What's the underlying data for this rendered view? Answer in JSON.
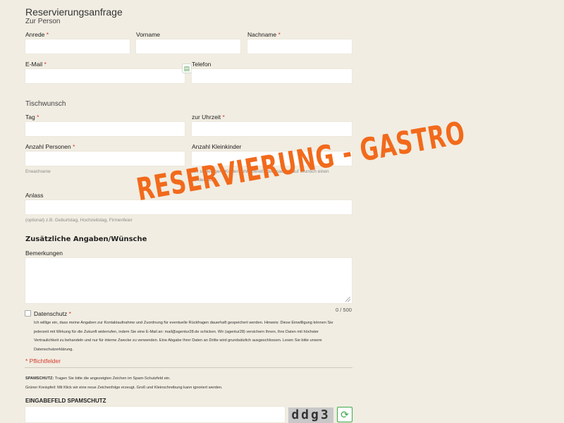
{
  "form": {
    "title": "Reservierungsanfrage",
    "section_person": "Zur Person",
    "anrede": "Anrede",
    "vorname": "Vorname",
    "nachname": "Nachname",
    "email": "E-Mail",
    "telefon": "Telefon",
    "section_tisch": "Tischwunsch",
    "tag": "Tag",
    "uhrzeit": "zur Uhrzeit",
    "personen": "Anzahl Personen",
    "personen_hint": "Erwachsene",
    "kleinkinder": "Anzahl Kleinkinder",
    "kleinkinder_hint_1": "Wir stellen gern Kinderstühle bereit oder machen auf Wunsch einen",
    "kleinkinder_hint_2": "Kindertisch.",
    "anlass": "Anlass",
    "anlass_hint": "(optional) z.B. Geburtstag, Hochzeitstag, Firmenfeier",
    "zusaetzliche": "Zusätzliche Angaben/Wünsche",
    "bemerkungen": "Bemerkungen",
    "counter": "0 / 500",
    "datenschutz": "Datenschutz",
    "consent_1": "Ich willige ein, dass meine Angaben zur Kontaktaufnahme und Zuordnung für eventuelle Rückfragen dauerhaft gespeichert werden. Hinweis: Diese Einwilligung können Sie",
    "consent_2": "jederzeit mit Wirkung für die Zukunft widerrufen, indem Sie eine E-Mail an: mail@agentur28.de schicken. Wir (agentur28) versichern Ihnen, Ihre Daten mit höchster",
    "consent_3": "Vertraulichkeit zu behandeln und nur für interne Zwecke zu verwenden. Eine Abgabe Ihrer Daten an Dritte wird grundsätzlich ausgeschlossen. Lesen Sie bitte unsere",
    "consent_4": "Datenschutzerklärung.",
    "pflicht": "* Pflichtfelder",
    "spam_label": "SPAMSCHUTZ:",
    "spam_text": " Tragen Sie bitte die angezeigten Zeichen im Spam-Schutzfeld ein.",
    "spam_text_2": "Grüner Kreispfeil: Mit Klick wir eine neue Zeichenfolge erzeugt. Groß und Kleinschreibung kann ignoriert werden.",
    "spam_field": "EINGABEFELD SPAMSCHUTZ",
    "captcha": "ddg3",
    "required_mark": "*"
  },
  "overlay": {
    "text": "RESERVIERUNG - GASTRO",
    "color": "#f26a1b"
  },
  "icons": {
    "refresh": "refresh-icon",
    "autofill": "autofill-icon"
  }
}
